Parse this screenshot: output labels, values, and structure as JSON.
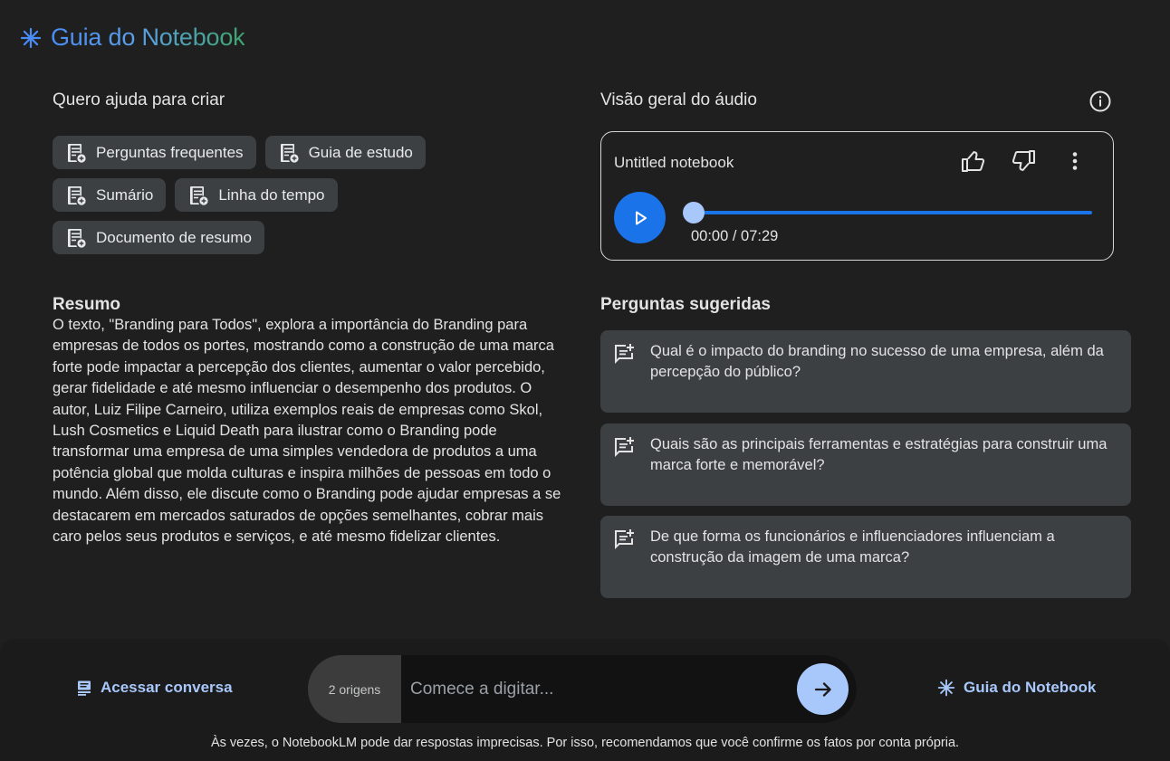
{
  "header": {
    "title": "Guia do Notebook",
    "icon": "sparkle-icon"
  },
  "create": {
    "heading": "Quero ajuda para criar",
    "chips": [
      {
        "label": "Perguntas frequentes",
        "icon": "note-add-icon"
      },
      {
        "label": "Guia de estudo",
        "icon": "note-add-icon"
      },
      {
        "label": "Sumário",
        "icon": "note-add-icon"
      },
      {
        "label": "Linha do tempo",
        "icon": "note-add-icon"
      },
      {
        "label": "Documento de resumo",
        "icon": "note-add-icon"
      }
    ]
  },
  "summary": {
    "heading": "Resumo",
    "text": "O texto, \"Branding para Todos\", explora a importância do Branding para empresas de todos os portes, mostrando como a construção de uma marca forte pode impactar a percepção dos clientes, aumentar o valor percebido, gerar fidelidade e até mesmo influenciar o desempenho dos produtos. O autor, Luiz Filipe Carneiro, utiliza exemplos reais de empresas como Skol, Lush Cosmetics e Liquid Death para ilustrar como o Branding pode transformar uma empresa de uma simples vendedora de produtos a uma potência global que molda culturas e inspira milhões de pessoas em todo o mundo. Além disso, ele discute como o Branding pode ajudar empresas a se destacarem em mercados saturados de opções semelhantes, cobrar mais caro pelos seus produtos e serviços, e até mesmo fidelizar clientes."
  },
  "audio": {
    "heading": "Visão geral do áudio",
    "notebook_title": "Untitled notebook",
    "time": "00:00 / 07:29",
    "progress": 0
  },
  "suggested": {
    "heading": "Perguntas sugeridas",
    "questions": [
      "Qual é o impacto do branding no sucesso de uma empresa, além da percepção do público?",
      "Quais são as principais ferramentas e estratégias para construir uma marca forte e memorável?",
      "De que forma os funcionários e influenciadores influenciam a construção da imagem de uma marca?"
    ]
  },
  "footer": {
    "access_label": "Acessar conversa",
    "sources_label": "2 origens",
    "input_placeholder": "Comece a digitar...",
    "guide_label": "Guia do Notebook",
    "disclaimer": "Às vezes, o NotebookLM pode dar respostas imprecisas. Por isso, recomendamos que você confirme os fatos por conta própria."
  },
  "colors": {
    "accent": "#1a73e8",
    "accent_light": "#a8c7fa",
    "card": "#3c4043",
    "background": "#1f1f1f"
  }
}
